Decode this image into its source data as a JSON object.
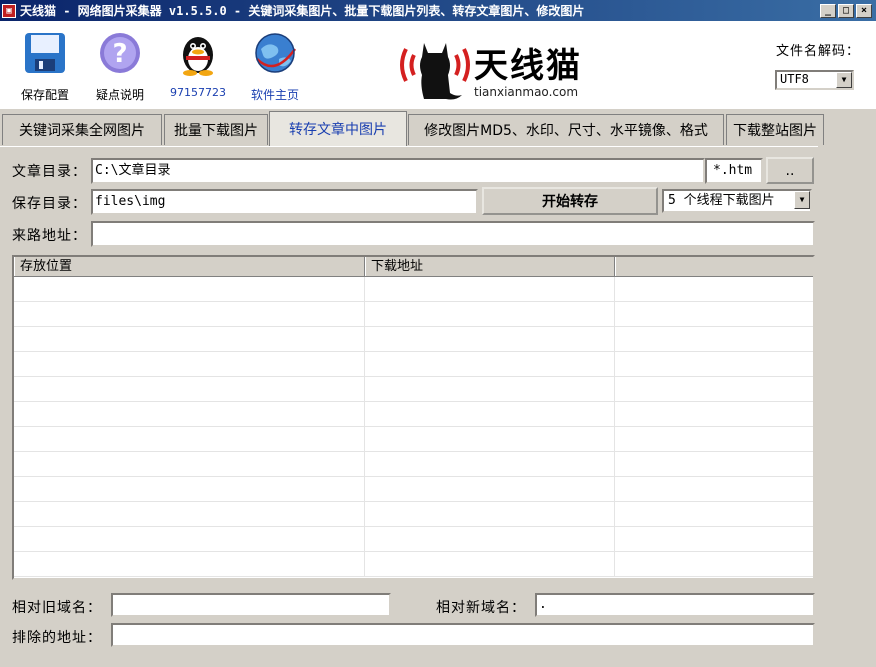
{
  "window": {
    "title": "天线猫 - 网络图片采集器 v1.5.5.0 - 关键词采集图片、批量下载图片列表、转存文章图片、修改图片",
    "controls": [
      "_",
      "□",
      "×"
    ]
  },
  "toolbar": {
    "items": [
      {
        "label": "保存配置",
        "icon": "floppy-disk-icon"
      },
      {
        "label": "疑点说明",
        "icon": "help-icon"
      },
      {
        "label": "97157723",
        "icon": "qq-penguin-icon"
      },
      {
        "label": "软件主页",
        "icon": "globe-icon"
      }
    ],
    "logo": {
      "name": "天线猫",
      "domain": "tianxianmao.com"
    },
    "encoding_label": "文件名解码：",
    "encoding_value": "UTF8"
  },
  "tabs": [
    {
      "label": "关键词采集全网图片",
      "active": false
    },
    {
      "label": "批量下载图片",
      "active": false
    },
    {
      "label": "转存文章中图片",
      "active": true
    },
    {
      "label": "修改图片MD5、水印、尺寸、水平镜像、格式",
      "active": false
    },
    {
      "label": "下载整站图片",
      "active": false
    }
  ],
  "form": {
    "article_dir_label": "文章目录：",
    "article_dir_value": "C:\\文章目录",
    "ext_value": "*.htm",
    "browse_label": "..",
    "save_dir_label": "保存目录：",
    "save_dir_value": "files\\img",
    "start_label": "开始转存",
    "threads_value": "5 个线程下载图片",
    "referer_label": "来路地址：",
    "referer_value": ""
  },
  "table": {
    "columns": [
      "存放位置",
      "下载地址",
      ""
    ],
    "rows": 12
  },
  "footer": {
    "old_domain_label": "相对旧域名：",
    "old_domain_value": "",
    "new_domain_label": "相对新域名：",
    "new_domain_value": ".",
    "exclude_label": "排除的地址：",
    "exclude_value": ""
  },
  "colors": {
    "titlebar": "#0a246a",
    "active_tab_text": "#1a3fb0",
    "logo_red": "#d42020"
  }
}
